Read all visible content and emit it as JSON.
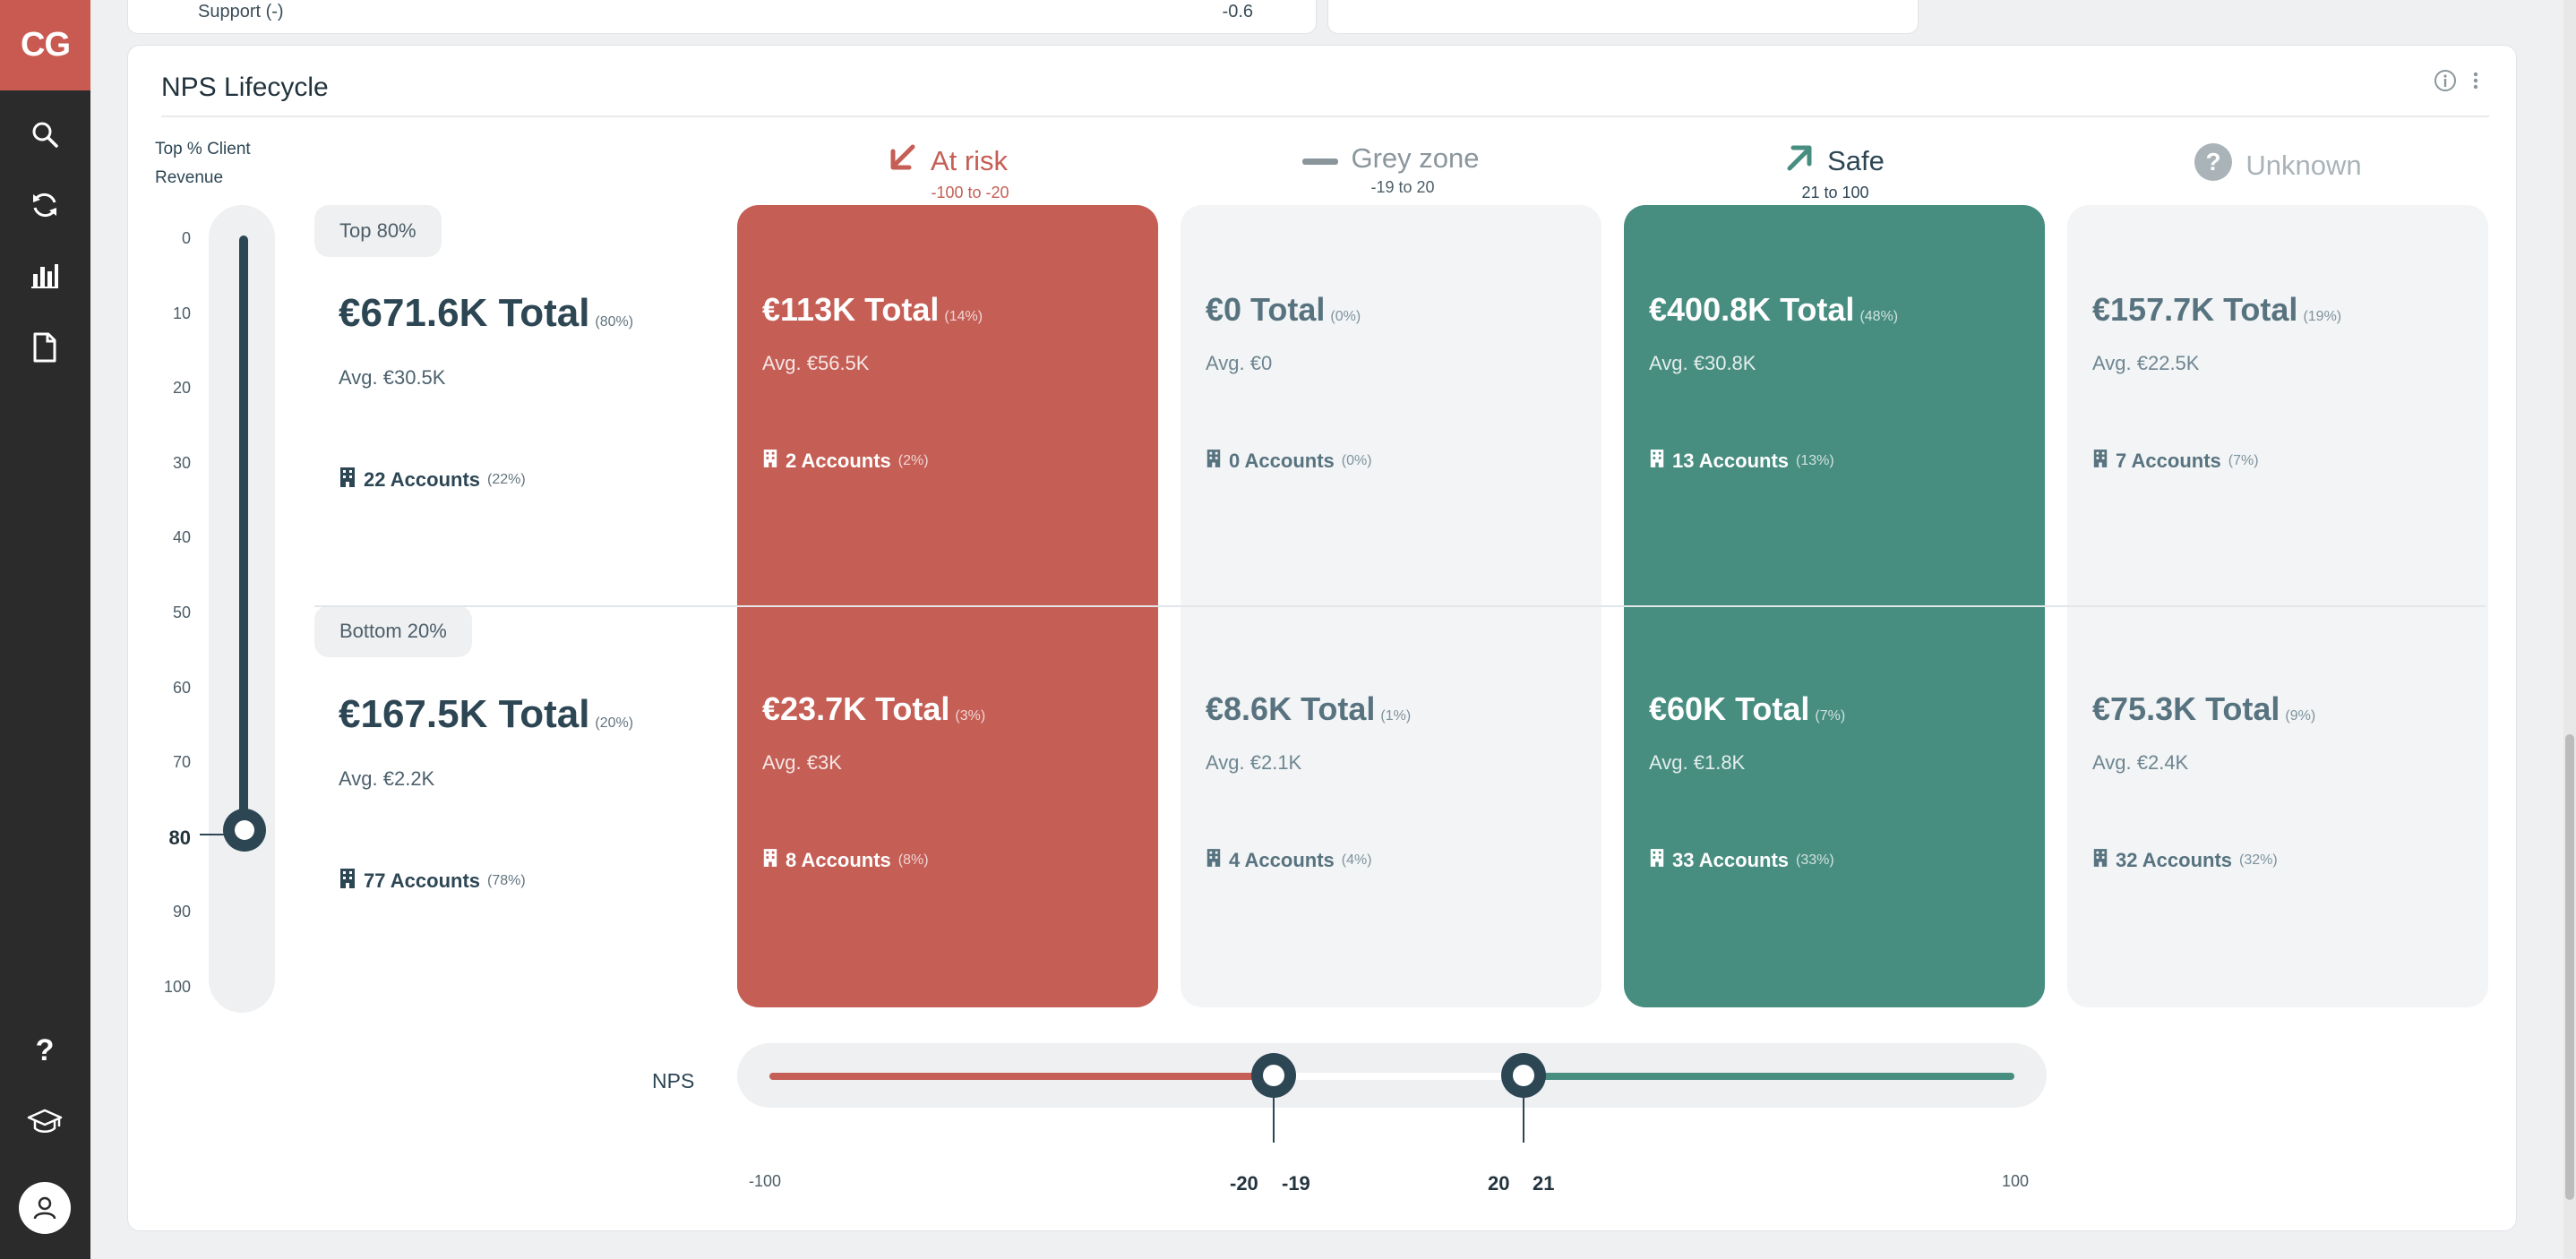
{
  "sidebar": {
    "logo": "CG",
    "icons": [
      "search-icon",
      "refresh-icon",
      "bar-chart-icon",
      "document-icon",
      "help-icon",
      "graduation-cap-icon",
      "user-icon"
    ]
  },
  "top_card": {
    "label": "Support (-)",
    "value": "-0.6"
  },
  "panel": {
    "title": "NPS Lifecycle"
  },
  "revenue_axis": {
    "title_line1": "Top % Client",
    "title_line2": "Revenue",
    "ticks": [
      "0",
      "10",
      "20",
      "30",
      "40",
      "50",
      "60",
      "70",
      "80",
      "90",
      "100"
    ],
    "selected_value": 80
  },
  "segments": {
    "top_label": "Top 80%",
    "bottom_label": "Bottom 20%"
  },
  "overall": {
    "top": {
      "total": "€671.6K Total",
      "pct": "(80%)",
      "avg": "Avg. €30.5K",
      "accounts": "22 Accounts",
      "accounts_pct": "(22%)"
    },
    "bottom": {
      "total": "€167.5K Total",
      "pct": "(20%)",
      "avg": "Avg. €2.2K",
      "accounts": "77 Accounts",
      "accounts_pct": "(78%)"
    }
  },
  "columns": [
    {
      "name": "At risk",
      "range": "-100 to -20",
      "icon": "arrow-down-left-icon",
      "color": "#c55e55",
      "top": {
        "total": "€113K Total",
        "pct": "(14%)",
        "avg": "Avg. €56.5K",
        "accounts": "2 Accounts",
        "accounts_pct": "(2%)"
      },
      "bottom": {
        "total": "€23.7K Total",
        "pct": "(3%)",
        "avg": "Avg. €3K",
        "accounts": "8 Accounts",
        "accounts_pct": "(8%)"
      }
    },
    {
      "name": "Grey zone",
      "range": "-19 to 20",
      "icon": "dash-icon",
      "color": "#8b969c",
      "top": {
        "total": "€0 Total",
        "pct": "(0%)",
        "avg": "Avg. €0",
        "accounts": "0 Accounts",
        "accounts_pct": "(0%)"
      },
      "bottom": {
        "total": "€8.6K Total",
        "pct": "(1%)",
        "avg": "Avg. €2.1K",
        "accounts": "4 Accounts",
        "accounts_pct": "(4%)"
      }
    },
    {
      "name": "Safe",
      "range": "21 to 100",
      "icon": "arrow-up-right-icon",
      "color": "#478d80",
      "top": {
        "total": "€400.8K Total",
        "pct": "(48%)",
        "avg": "Avg. €30.8K",
        "accounts": "13 Accounts",
        "accounts_pct": "(13%)"
      },
      "bottom": {
        "total": "€60K Total",
        "pct": "(7%)",
        "avg": "Avg. €1.8K",
        "accounts": "33 Accounts",
        "accounts_pct": "(33%)"
      }
    },
    {
      "name": "Unknown",
      "range": "",
      "icon": "question-circle-icon",
      "color": "#a9b3b8",
      "top": {
        "total": "€157.7K Total",
        "pct": "(19%)",
        "avg": "Avg. €22.5K",
        "accounts": "7 Accounts",
        "accounts_pct": "(7%)"
      },
      "bottom": {
        "total": "€75.3K Total",
        "pct": "(9%)",
        "avg": "Avg. €2.4K",
        "accounts": "32 Accounts",
        "accounts_pct": "(32%)"
      }
    }
  ],
  "nps_slider": {
    "label": "NPS",
    "min": "-100",
    "max": "100",
    "low_handle": "-20",
    "low_next": "-19",
    "high_handle": "20",
    "high_next": "21"
  }
}
